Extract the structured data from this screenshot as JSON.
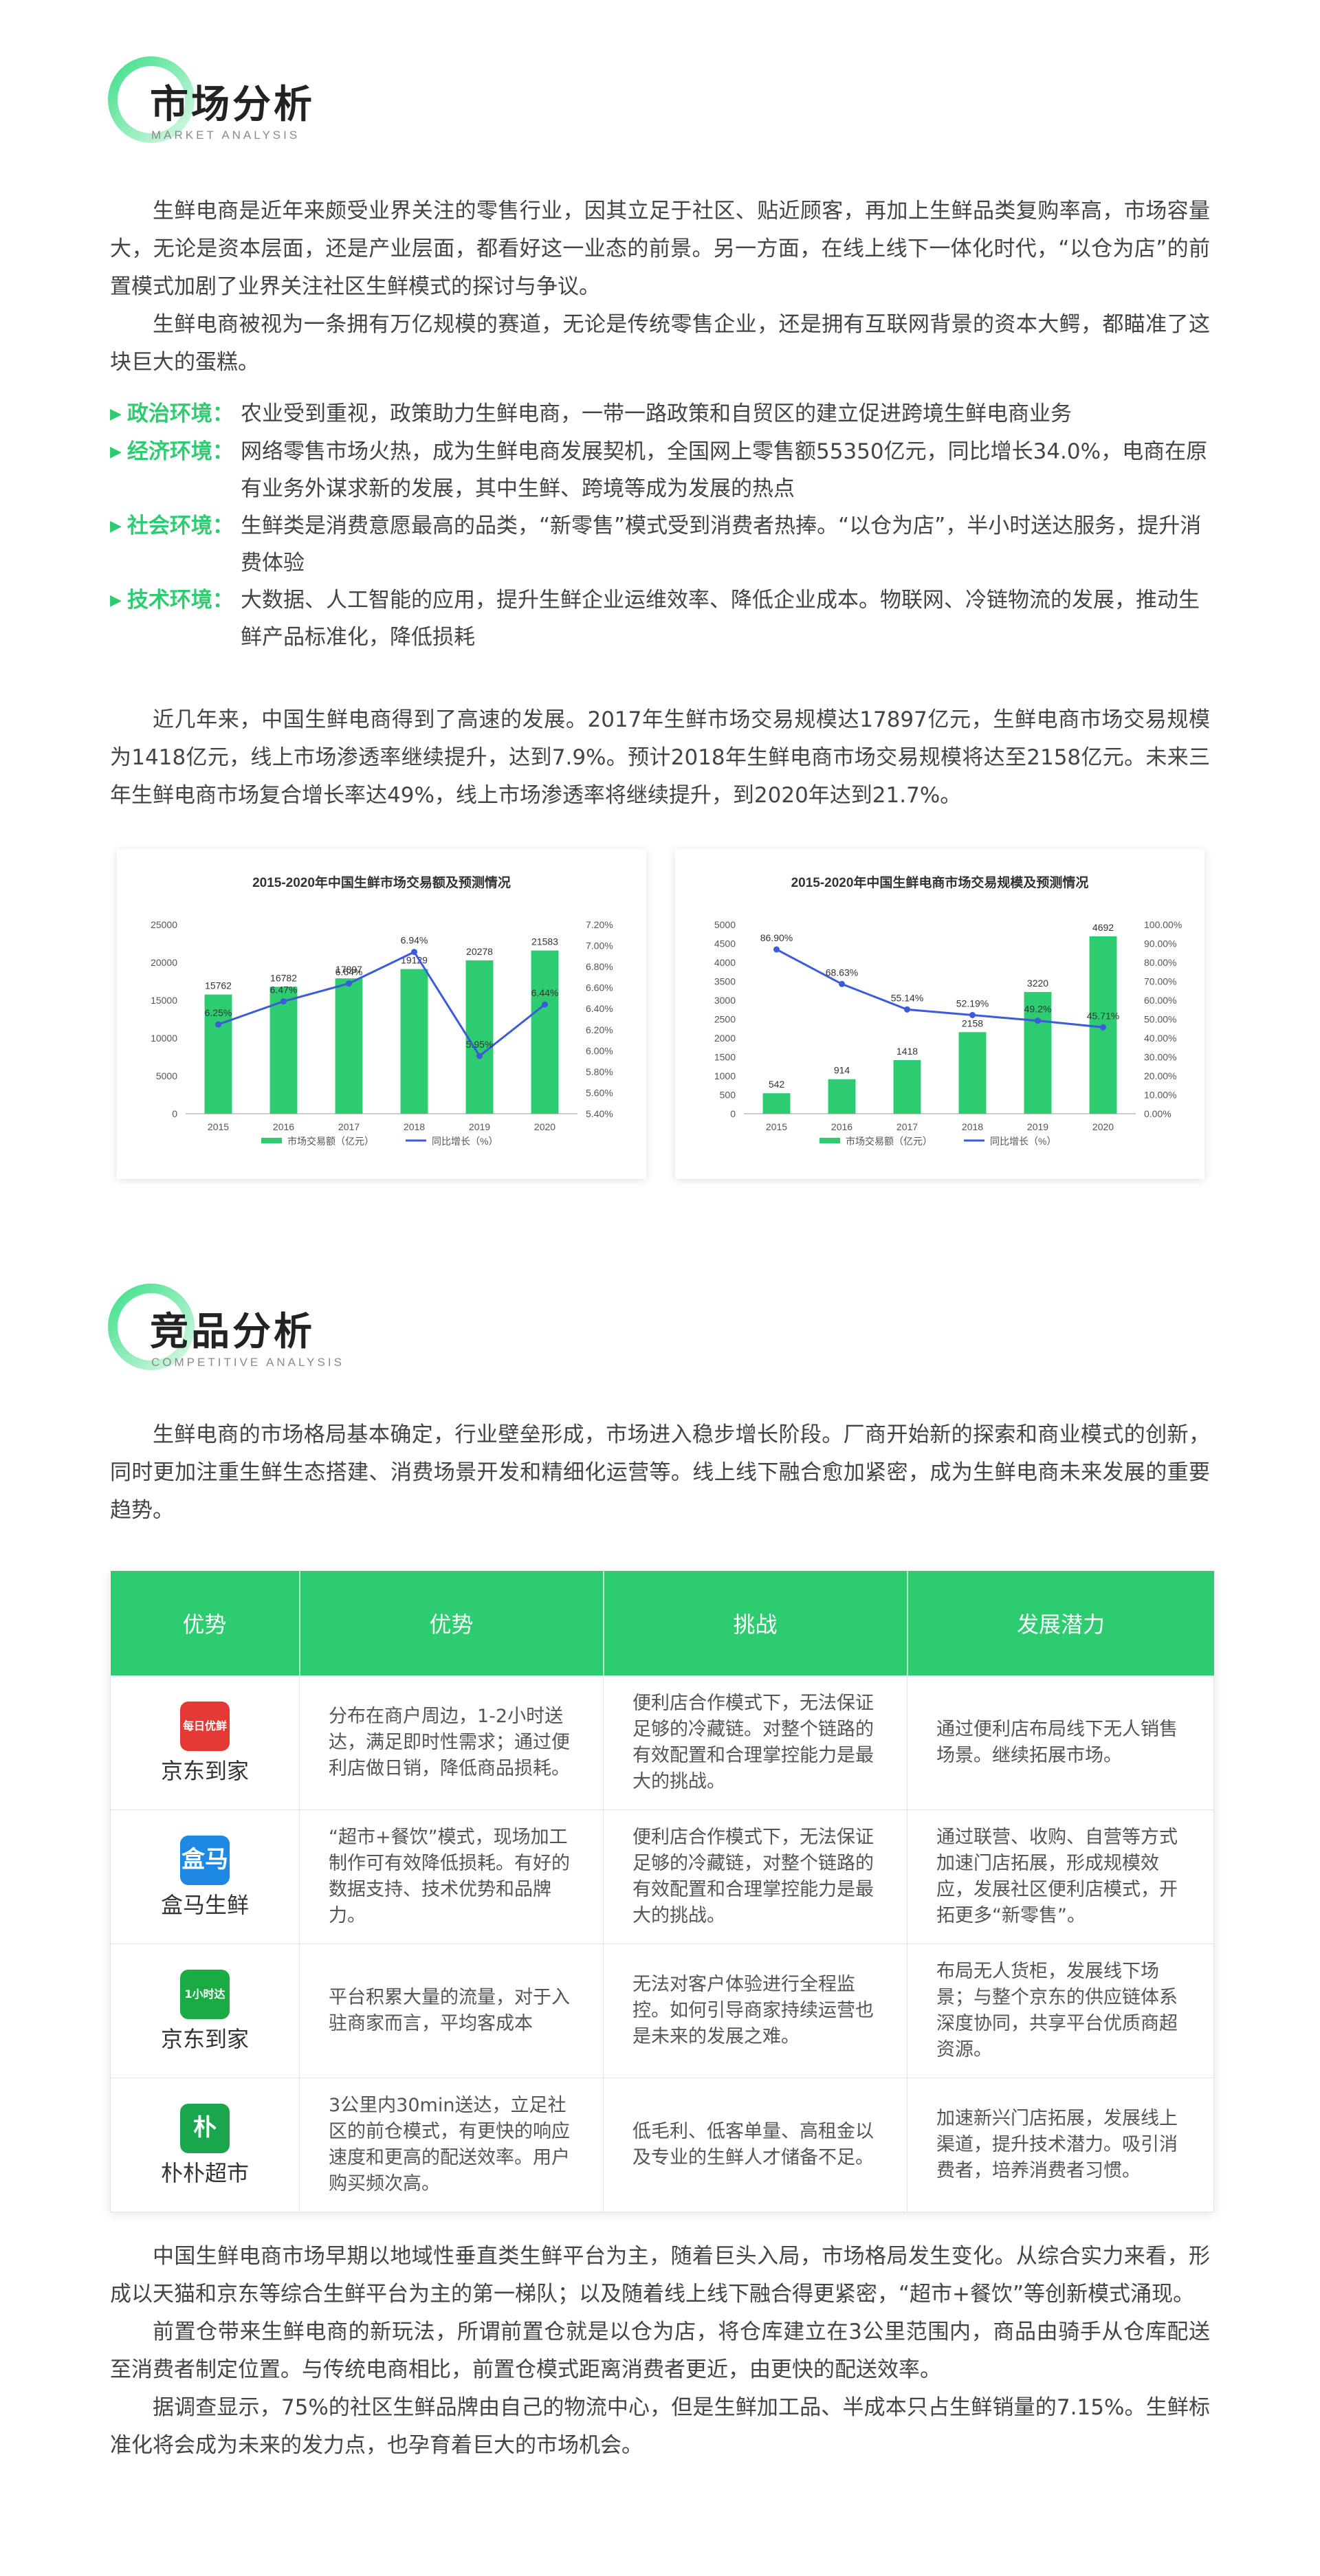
{
  "market": {
    "title": "市场分析",
    "subtitle": "MARKET ANALYSIS",
    "paragraphs": [
      "生鲜电商是近年来颇受业界关注的零售行业，因其立足于社区、贴近顾客，再加上生鲜品类复购率高，市场容量大，无论是资本层面，还是产业层面，都看好这一业态的前景。另一方面，在线上线下一体化时代，“以仓为店”的前置模式加剧了业界关注社区生鲜模式的探讨与争议。",
      "生鲜电商被视为一条拥有万亿规模的赛道，无论是传统零售企业，还是拥有互联网背景的资本大鳄，都瞄准了这块巨大的蛋糕。"
    ],
    "environments": [
      {
        "label": "政治环境：",
        "text": "农业受到重视，政策助力生鲜电商，一带一路政策和自贸区的建立促进跨境生鲜电商业务"
      },
      {
        "label": "经济环境：",
        "text": "网络零售市场火热，成为生鲜电商发展契机，全国网上零售额55350亿元，同比增长34.0%，电商在原有业务外谋求新的发展，其中生鲜、跨境等成为发展的热点"
      },
      {
        "label": "社会环境：",
        "text": "生鲜类是消费意愿最高的品类，“新零售”模式受到消费者热捧。“以仓为店”，半小时送达服务，提升消费体验"
      },
      {
        "label": "技术环境：",
        "text": "大数据、人工智能的应用，提升生鲜企业运维效率、降低企业成本。物联网、冷链物流的发展，推动生鲜产品标准化，降低损耗"
      }
    ],
    "growth_paragraph": "近几年来，中国生鲜电商得到了高速的发展。2017年生鲜市场交易规模达17897亿元，生鲜电商市场交易规模为1418亿元，线上市场渗透率继续提升，达到7.9%。预计2018年生鲜电商市场交易规模将达至2158亿元。未来三年生鲜电商市场复合增长率达49%，线上市场渗透率将继续提升，到2020年达到21.7%。"
  },
  "chart_data": [
    {
      "type": "bar",
      "title": "2015-2020年中国生鲜市场交易额及预测情况",
      "categories": [
        "2015",
        "2016",
        "2017",
        "2018",
        "2019",
        "2020"
      ],
      "series": [
        {
          "name": "市场交易额（亿元）",
          "type": "bar",
          "axis": "left",
          "values": [
            15762,
            16782,
            17897,
            19129,
            20278,
            21583
          ],
          "labels": [
            "15762",
            "16782",
            "17897",
            "19129",
            "20278",
            "21583"
          ]
        },
        {
          "name": "同比增长（%）",
          "type": "line",
          "axis": "right",
          "values": [
            6.25,
            6.47,
            6.64,
            6.94,
            5.95,
            6.44
          ],
          "labels": [
            "6.25%",
            "6.47%",
            "6.64%",
            "6.94%",
            "5.95%",
            "6.44%"
          ]
        }
      ],
      "ylim_left": [
        0,
        25000
      ],
      "yticks_left": [
        "0",
        "5000",
        "10000",
        "15000",
        "20000",
        "25000"
      ],
      "ylim_right": [
        5.4,
        7.2
      ],
      "yticks_right": [
        "5.40%",
        "5.60%",
        "5.80%",
        "6.00%",
        "6.20%",
        "6.40%",
        "6.60%",
        "6.80%",
        "7.00%",
        "7.20%"
      ],
      "legend_position": "bottom",
      "colors": {
        "bar": "#2ecc71",
        "line": "#3b5bdb"
      }
    },
    {
      "type": "bar",
      "title": "2015-2020年中国生鲜电商市场交易规模及预测情况",
      "categories": [
        "2015",
        "2016",
        "2017",
        "2018",
        "2019",
        "2020"
      ],
      "series": [
        {
          "name": "市场交易额（亿元）",
          "type": "bar",
          "axis": "left",
          "values": [
            542,
            914,
            1418,
            2158,
            3220,
            4692
          ],
          "labels": [
            "542",
            "914",
            "1418",
            "2158",
            "3220",
            "4692"
          ]
        },
        {
          "name": "同比增长（%）",
          "type": "line",
          "axis": "right",
          "values": [
            86.9,
            68.63,
            55.14,
            52.19,
            49.2,
            45.71
          ],
          "labels": [
            "86.90%",
            "68.63%",
            "55.14%",
            "52.19%",
            "49.2%",
            "45.71%"
          ]
        }
      ],
      "ylim_left": [
        0,
        5000
      ],
      "yticks_left": [
        "0",
        "500",
        "1000",
        "1500",
        "2000",
        "2500",
        "3000",
        "3500",
        "4000",
        "4500",
        "5000"
      ],
      "ylim_right": [
        0,
        100
      ],
      "yticks_right": [
        "0.00%",
        "10.00%",
        "20.00%",
        "30.00%",
        "40.00%",
        "50.00%",
        "60.00%",
        "70.00%",
        "80.00%",
        "90.00%",
        "100.00%"
      ],
      "legend_position": "bottom",
      "colors": {
        "bar": "#2ecc71",
        "line": "#3b5bdb"
      }
    }
  ],
  "competition": {
    "title": "竞品分析",
    "subtitle": "COMPETITIVE ANALYSIS",
    "intro": "生鲜电商的市场格局基本确定，行业壁垒形成，市场进入稳步增长阶段。厂商开始新的探索和商业模式的创新，同时更加注重生鲜生态搭建、消费场景开发和精细化运营等。线上线下融合愈加紧密，成为生鲜电商未来发展的重要趋势。",
    "table": {
      "headers": [
        "优势",
        "优势",
        "挑战",
        "发展潜力"
      ],
      "rows": [
        {
          "brand": "京东到家",
          "logo_text": "每日优鲜",
          "logo_color": "#e53935",
          "logo_icon": "missfresh-logo-icon",
          "advantage": "分布在商户周边，1-2小时送达，满足即时性需求；通过便利店做日销，降低商品损耗。",
          "challenge": "便利店合作模式下，无法保证足够的冷藏链。对整个链路的有效配置和合理掌控能力是最大的挑战。",
          "potential": "通过便利店布局线下无人销售场景。继续拓展市场。"
        },
        {
          "brand": "盒马生鲜",
          "logo_text": "盒马",
          "logo_color": "#1e88e5",
          "logo_icon": "hema-logo-icon",
          "advantage": "“超市+餐饮”模式，现场加工制作可有效降低损耗。有好的数据支持、技术优势和品牌力。",
          "challenge": "便利店合作模式下，无法保证足够的冷藏链，对整个链路的有效配置和合理掌控能力是最大的挑战。",
          "potential": "通过联营、收购、自营等方式加速门店拓展，形成规模效应，发展社区便利店模式，开拓更多“新零售”。"
        },
        {
          "brand": "京东到家",
          "logo_text": "1小时达",
          "logo_color": "#1aab44",
          "logo_icon": "jddj-logo-icon",
          "advantage": "平台积累大量的流量，对于入驻商家而言，平均客成本",
          "challenge": "无法对客户体验进行全程监控。如何引导商家持续运营也是未来的发展之难。",
          "potential": "布局无人货柜，发展线下场景；与整个京东的供应链体系深度协同，共享平台优质商超资源。"
        },
        {
          "brand": "朴朴超市",
          "logo_text": "朴",
          "logo_color": "#1aa64c",
          "logo_icon": "pupu-logo-icon",
          "advantage": "3公里内30min送达，立足社区的前仓模式，有更快的响应速度和更高的配送效率。用户购买频次高。",
          "challenge": "低毛利、低客单量、高租金以及专业的生鲜人才储备不足。",
          "potential": "加速新兴门店拓展，发展线上渠道，提升技术潜力。吸引消费者，培养消费者习惯。"
        }
      ]
    },
    "closing": [
      "中国生鲜电商市场早期以地域性垂直类生鲜平台为主，随着巨头入局，市场格局发生变化。从综合实力来看，形成以天猫和京东等综合生鲜平台为主的第一梯队；以及随着线上线下融合得更紧密，“超市+餐饮”等创新模式涌现。",
      "前置仓带来生鲜电商的新玩法，所谓前置仓就是以仓为店，将仓库建立在3公里范围内，商品由骑手从仓库配送至消费者制定位置。与传统电商相比，前置仓模式距离消费者更近，由更快的配送效率。",
      "据调查显示，75%的社区生鲜品牌由自己的物流中心，但是生鲜加工品、半成本只占生鲜销量的7.15%。生鲜标准化将会成为未来的发力点，也孕育着巨大的市场机会。"
    ]
  }
}
